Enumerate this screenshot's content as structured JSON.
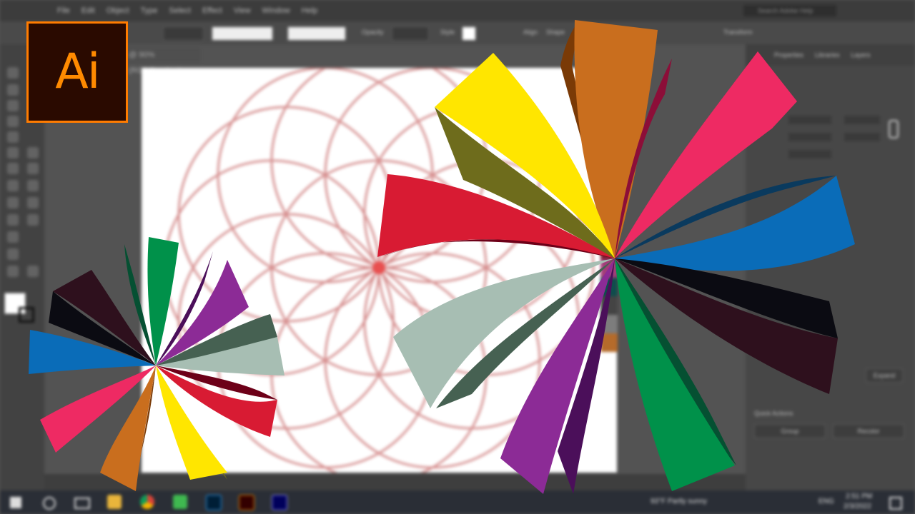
{
  "menu": {
    "items": [
      "File",
      "Edit",
      "Object",
      "Type",
      "Select",
      "Effect",
      "View",
      "Window",
      "Help"
    ],
    "search_placeholder": "Search Adobe Help"
  },
  "options_bar": {
    "opacity_label": "Opacity",
    "style_label": "Style",
    "align_label": "Align",
    "shape_label": "Shape",
    "transform_label": "Transform"
  },
  "document": {
    "tab_title": "@ 90% (RGB/Preview)"
  },
  "panel": {
    "tabs": [
      "Properties",
      "Libraries",
      "Layers"
    ],
    "quick_actions_label": "Quick Actions",
    "group_button": "Group",
    "recolor_button": "Recolor",
    "expand_button": "Expand"
  },
  "taskbar": {
    "weather": "93°F  Partly sunny",
    "language": "ENG",
    "time": "2:51 PM",
    "date": "2/3/2022"
  },
  "logo": {
    "text": "Ai"
  },
  "colors": {
    "accent": "#FF7C00",
    "yellow": "#FFE600",
    "orange": "#C96E1E",
    "pink": "#EE2A63",
    "blue": "#0A6CB8",
    "black": "#0B0B12",
    "dark_maroon": "#2E101D",
    "green": "#00914A",
    "purple": "#8C2B96",
    "sage": "#A7BEB3",
    "red": "#D81B33",
    "olive": "#6E6C1C",
    "dark_green": "#466152"
  }
}
